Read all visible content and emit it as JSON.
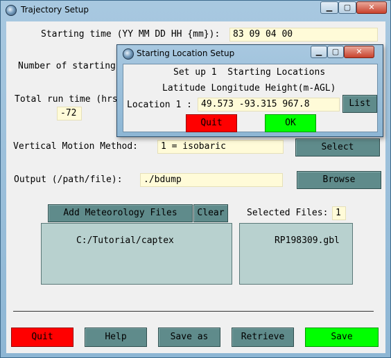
{
  "window": {
    "title": "Trajectory Setup",
    "minimize": "▁",
    "maximize": "▢",
    "close": "✕"
  },
  "form": {
    "start_time_label": "Starting time (YY MM DD HH {mm}):",
    "start_time_value": "83 09 04 00",
    "num_start_label": "Number of starting",
    "run_time_label": "Total run time (hrs",
    "run_time_value": "-72",
    "vertical_label": "Vertical Motion Method:",
    "vertical_value": "1 = isobaric",
    "select_label": "Select",
    "output_label": "Output (/path/file):",
    "output_value": "./bdump",
    "browse_label": "Browse"
  },
  "met": {
    "add_label": "Add Meteorology Files",
    "clear_label": "Clear",
    "selected_label": "Selected Files:",
    "selected_count": "1",
    "dir": "C:/Tutorial/captex",
    "file": "RP198309.gbl"
  },
  "footer": {
    "quit": "Quit",
    "help": "Help",
    "save_as": "Save as",
    "retrieve": "Retrieve",
    "save": "Save"
  },
  "dialog": {
    "title": "Starting Location Setup",
    "heading": "Set up 1  Starting Locations",
    "columns": "Latitude Longitude Height(m-AGL)",
    "location_label": "Location 1 :",
    "location_value": "49.573 -93.315 967.8",
    "list": "List",
    "quit": "Quit",
    "ok": "OK",
    "minimize": "▁",
    "maximize": "▢",
    "close": "✕"
  },
  "colors": {
    "field_bg": "#fffbd8",
    "button": "#5f8b8b",
    "quit": "#ff0000",
    "save": "#00ff00",
    "listbox": "#b8d1cf"
  }
}
